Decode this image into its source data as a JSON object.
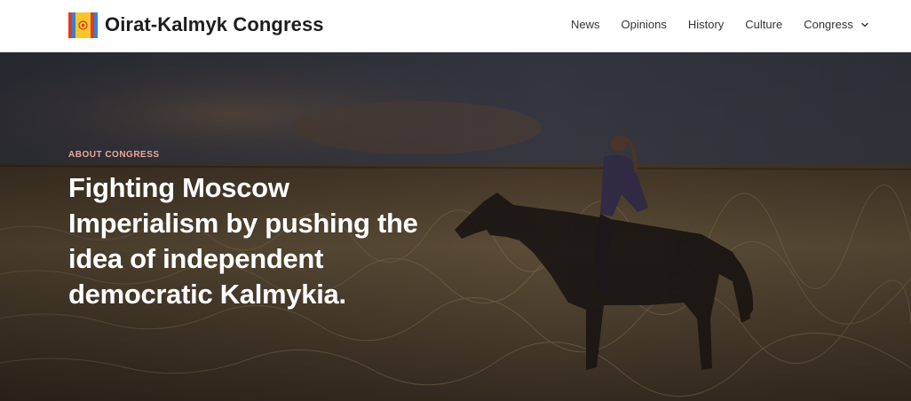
{
  "header": {
    "site_title": "Oirat-Kalmyk Congress",
    "logo_icon": "kalmyk-flag-logo",
    "nav": [
      {
        "label": "News"
      },
      {
        "label": "Opinions"
      },
      {
        "label": "History"
      },
      {
        "label": "Culture"
      },
      {
        "label": "Congress",
        "has_dropdown": true
      }
    ]
  },
  "hero": {
    "eyebrow": "ABOUT CONGRESS",
    "headline": "Fighting Moscow Imperialism by pushing the idea of independent democratic Kalmykia.",
    "background": "steppe-rider-photo",
    "colors": {
      "eyebrow": "#e8a99a",
      "headline": "#ffffff"
    }
  }
}
